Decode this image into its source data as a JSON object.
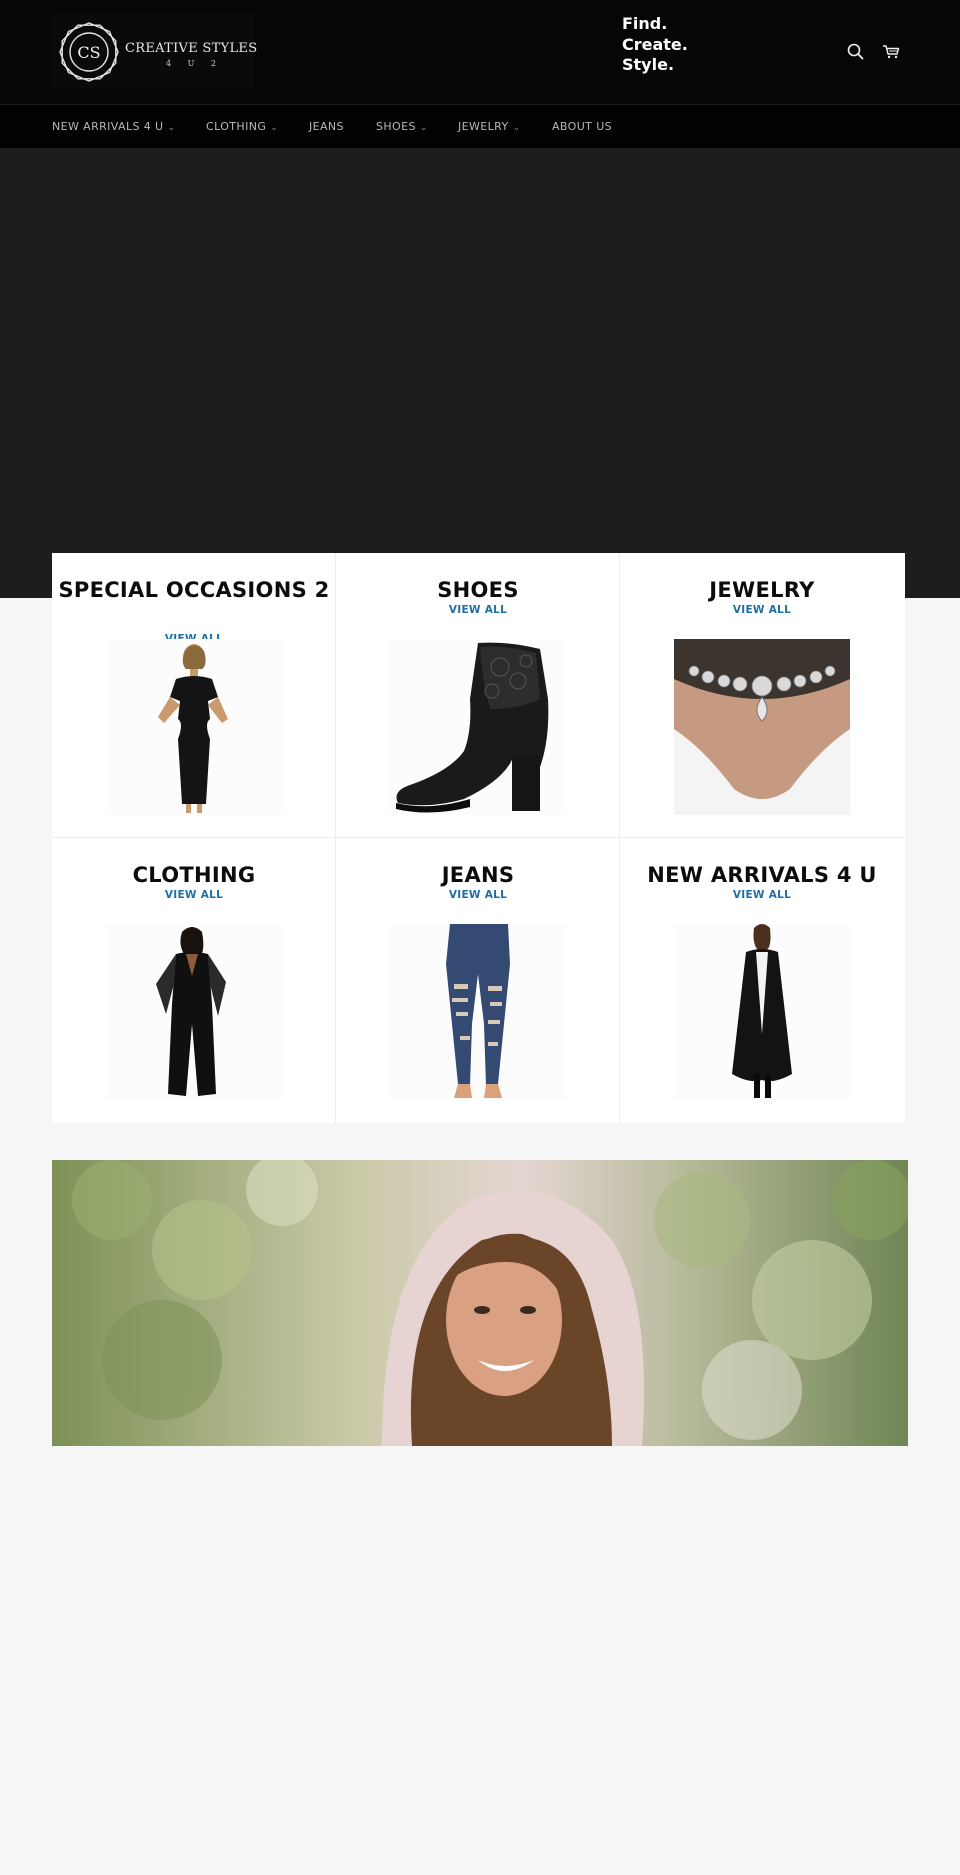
{
  "header": {
    "logo": {
      "monogram": "CS",
      "name": "CREATIVE STYLES",
      "sub": "4 U 2"
    },
    "tagline": [
      "Find.",
      "Create.",
      "Style."
    ],
    "icons": [
      "search-icon",
      "cart-icon"
    ]
  },
  "nav": {
    "items": [
      {
        "label": "NEW ARRIVALS 4 U",
        "has_dropdown": true
      },
      {
        "label": "CLOTHING",
        "has_dropdown": true
      },
      {
        "label": "JEANS",
        "has_dropdown": false
      },
      {
        "label": "SHOES",
        "has_dropdown": true
      },
      {
        "label": "JEWELRY",
        "has_dropdown": true
      },
      {
        "label": "ABOUT US",
        "has_dropdown": false
      }
    ]
  },
  "collections": [
    {
      "title": "SPECIAL OCCASIONS 2",
      "link": "VIEW ALL",
      "image": "black dress"
    },
    {
      "title": "SHOES",
      "link": "VIEW ALL",
      "image": "black lace ankle boot"
    },
    {
      "title": "JEWELRY",
      "link": "VIEW ALL",
      "image": "crystal choker necklace"
    },
    {
      "title": "CLOTHING",
      "link": "VIEW ALL",
      "image": "black jumpsuit"
    },
    {
      "title": "JEANS",
      "link": "VIEW ALL",
      "image": "ripped skinny jeans"
    },
    {
      "title": "NEW ARRIVALS 4 U",
      "link": "VIEW ALL",
      "image": "black long coat"
    }
  ],
  "banner": {
    "image": "smiling woman outdoors"
  },
  "colors": {
    "header_bg": "#060606",
    "nav_bg": "#020202",
    "hero_bg": "#1d1d1d",
    "page_bg": "#f6f6f6",
    "link": "#1d6fa5"
  }
}
